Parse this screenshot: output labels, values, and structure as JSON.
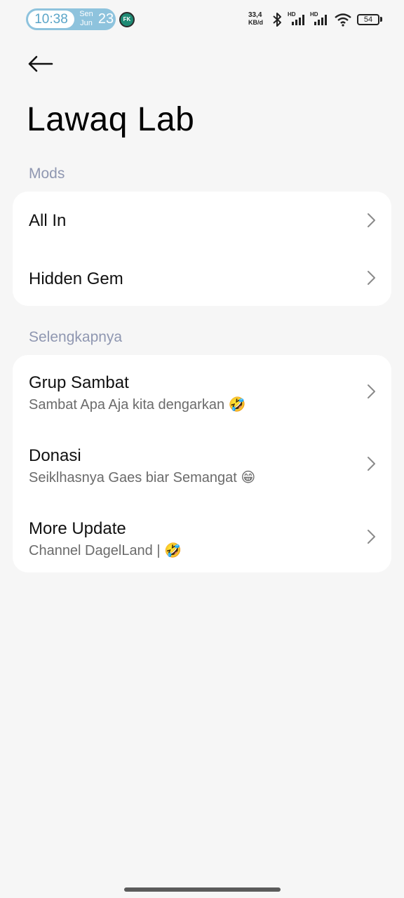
{
  "status_bar": {
    "time": "10:38",
    "day": "Sen",
    "month": "Jun",
    "date": "23",
    "app_badge": "FK",
    "net_speed_value": "33,4",
    "net_speed_unit": "KB/d",
    "hd_label_1": "HD",
    "hd_label_2": "HD",
    "battery": "54",
    "icons": [
      "bluetooth-icon",
      "signal-icon",
      "signal-icon",
      "wifi-icon",
      "battery-icon"
    ]
  },
  "header": {
    "back_icon": "arrow-left-icon",
    "title": "Lawaq Lab"
  },
  "sections": [
    {
      "label": "Mods",
      "items": [
        {
          "title": "All In"
        },
        {
          "title": "Hidden Gem"
        }
      ]
    },
    {
      "label": "Selengkapnya",
      "items": [
        {
          "title": "Grup Sambat",
          "subtitle": "Sambat Apa Aja kita dengarkan 🤣"
        },
        {
          "title": "Donasi",
          "subtitle": "Seiklhasnya Gaes biar Semangat 😁"
        },
        {
          "title": "More Update",
          "subtitle": "Channel DagelLand | 🤣"
        }
      ]
    }
  ],
  "colors": {
    "background": "#f6f6f6",
    "card": "#ffffff",
    "section_label": "#8f97b1",
    "clock_pill": "#8ec3dd"
  }
}
